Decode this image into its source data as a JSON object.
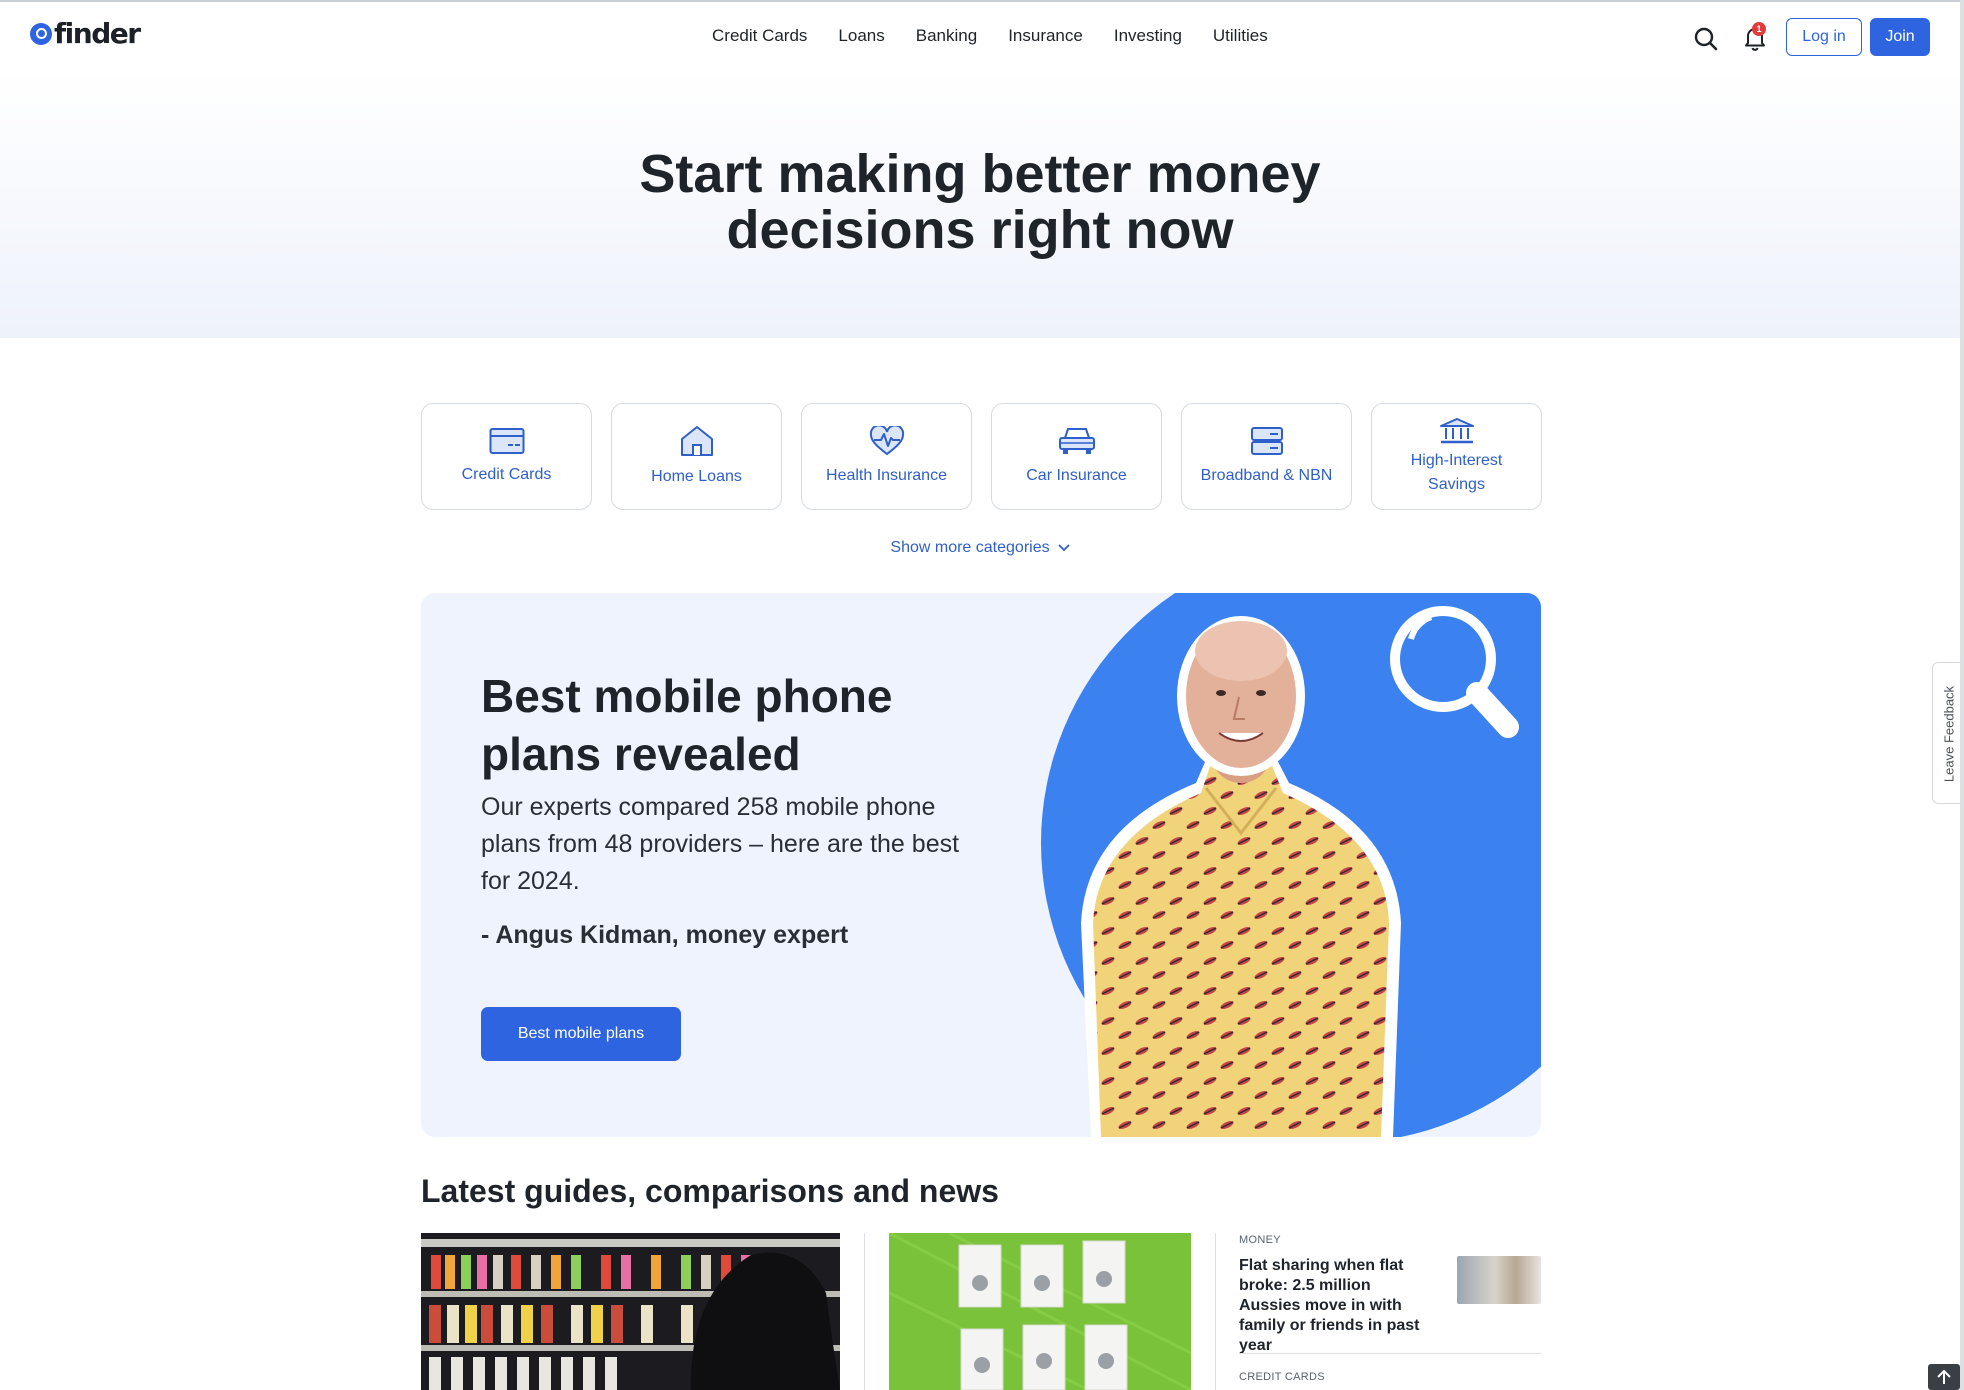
{
  "brand": {
    "name": "finder"
  },
  "nav": {
    "items": [
      "Credit Cards",
      "Loans",
      "Banking",
      "Insurance",
      "Investing",
      "Utilities"
    ],
    "notification_count": "1",
    "login_label": "Log in",
    "join_label": "Join"
  },
  "hero": {
    "title_line1": "Start making better money",
    "title_line2": "decisions right now"
  },
  "categories": {
    "items": [
      {
        "label": "Credit Cards",
        "icon": "credit-card-icon"
      },
      {
        "label": "Home Loans",
        "icon": "house-icon"
      },
      {
        "label": "Health Insurance",
        "icon": "heart-pulse-icon"
      },
      {
        "label": "Car Insurance",
        "icon": "car-icon"
      },
      {
        "label": "Broadband & NBN",
        "icon": "server-icon"
      },
      {
        "label": "High-Interest Savings",
        "icon": "bank-icon"
      }
    ],
    "show_more": "Show more categories"
  },
  "promo": {
    "title": "Best mobile phone plans revealed",
    "text": "Our experts compared 258 mobile phone plans from 48 providers – here are the best for 2024.",
    "author": "- Angus Kidman, money expert",
    "button": "Best mobile plans"
  },
  "latest": {
    "title": "Latest guides, comparisons and news",
    "news": [
      {
        "category": "MONEY",
        "title": "Flat sharing when flat broke: 2.5 million Aussies move in with family or friends in past year"
      },
      {
        "category": "CREDIT CARDS"
      }
    ]
  },
  "feedback": {
    "label": "Leave Feedback"
  },
  "colors": {
    "primary": "#2f64e0",
    "link": "#2f5fc9",
    "promo_bg": "#eef3fd",
    "promo_circle": "#3b82f0"
  }
}
